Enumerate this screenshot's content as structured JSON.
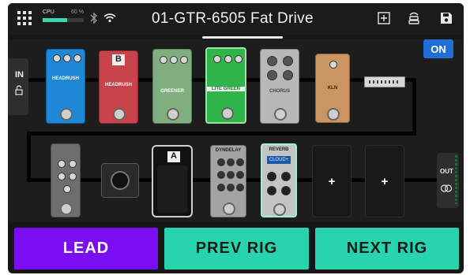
{
  "header": {
    "cpu_label": "CPU",
    "cpu_percent": "60 %",
    "cpu_load": 0.6,
    "preset_title": "01-GTR-6505 Fat Drive"
  },
  "chain": {
    "in_label": "IN",
    "out_label": "OUT",
    "on_label": "ON",
    "pedals": [
      {
        "name": "HEADRUSH",
        "color": "#1e88d6"
      },
      {
        "name": "HEADRUSH",
        "badge": "B",
        "color": "#c9434c"
      },
      {
        "name": "GREENER",
        "color": "#7fae7f"
      },
      {
        "name": "LITE GREEN",
        "color": "#2fb54a"
      },
      {
        "name": "CHORUS",
        "color": "#b8b8b8"
      },
      {
        "name": "KLN",
        "color": "#c99560"
      },
      {
        "name": "",
        "color": "#d8d8d8"
      },
      {
        "name": "",
        "color": "#6e6e6e"
      },
      {
        "name": "",
        "color": "#2a2a2a"
      },
      {
        "name": "",
        "badge": "A",
        "color": "#111111"
      },
      {
        "name": "DYNDELAY",
        "color": "#a3a3a3"
      },
      {
        "name": "REVERB",
        "display": "CLOUD+",
        "color": "#c4c4c4"
      }
    ],
    "empty_slots": [
      "+",
      "+"
    ]
  },
  "buttons": {
    "lead": "LEAD",
    "prev": "PREV RIG",
    "next": "NEXT RIG"
  },
  "colors": {
    "lead_bg": "#7b0df2",
    "rig_bg": "#27d4ad",
    "on_bg": "#1f6fd6"
  }
}
